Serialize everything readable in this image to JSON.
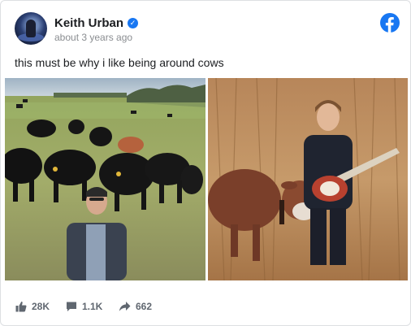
{
  "post": {
    "author": "Keith Urban",
    "verified": true,
    "timestamp": "about 3 years ago",
    "text": "this must be why i like being around cows"
  },
  "photos": [
    {
      "name": "man-with-cows-photo"
    },
    {
      "name": "boy-with-guitar-and-calf-photo"
    }
  ],
  "stats": {
    "likes": "28K",
    "comments": "1.1K",
    "shares": "662"
  },
  "colors": {
    "brand": "#1877f2",
    "text": "#1c1e21",
    "muted": "#8a8d91",
    "stat_text": "#606770"
  },
  "icons": {
    "verified": "check-badge-icon",
    "brand": "facebook-logo-icon",
    "likes": "thumbs-up-icon",
    "comments": "comment-bubble-icon",
    "shares": "share-arrow-icon"
  }
}
